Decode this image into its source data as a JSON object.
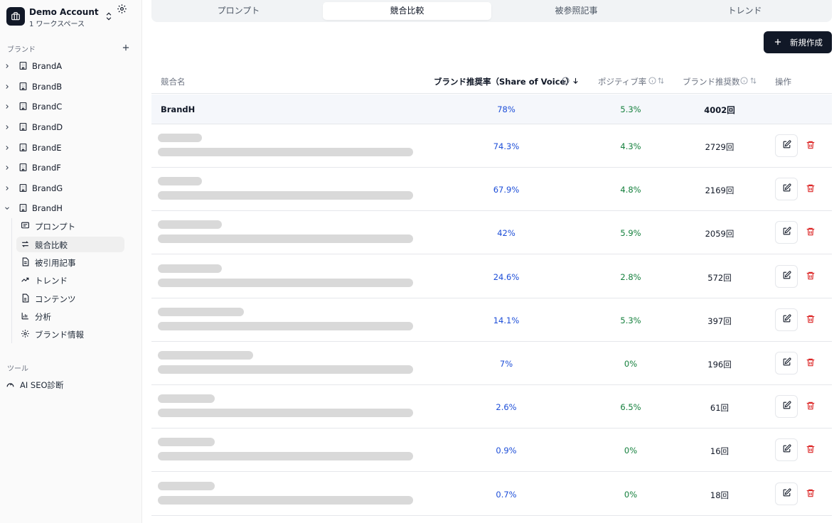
{
  "account": {
    "name": "Demo Account",
    "sub": "1 ワークスペース"
  },
  "sidebar": {
    "brand_section_label": "ブランド",
    "brands": [
      "BrandA",
      "BrandB",
      "BrandC",
      "BrandD",
      "BrandE",
      "BrandF",
      "BrandG",
      "BrandH"
    ],
    "expanded_brand": "BrandH",
    "subitems": [
      {
        "label": "プロンプト",
        "icon": "message-square-icon"
      },
      {
        "label": "競合比較",
        "icon": "arrows-swap-icon",
        "active": true
      },
      {
        "label": "被引用記事",
        "icon": "file-text-icon"
      },
      {
        "label": "トレンド",
        "icon": "trending-up-icon"
      },
      {
        "label": "コンテンツ",
        "icon": "file-icon"
      },
      {
        "label": "分析",
        "icon": "bar-chart-icon"
      },
      {
        "label": "ブランド情報",
        "icon": "gear-icon"
      }
    ],
    "tools_label": "ツール",
    "tools": [
      {
        "label": "AI SEO診断",
        "icon": "gauge-icon"
      }
    ]
  },
  "tabs": [
    {
      "label": "プロンプト"
    },
    {
      "label": "競合比較",
      "active": true
    },
    {
      "label": "被参照記事"
    },
    {
      "label": "トレンド"
    }
  ],
  "new_button": {
    "label": "新規作成"
  },
  "table": {
    "headers": {
      "name": "競合名",
      "sov": "ブランド推奨率（Share of Voice）",
      "positive": "ポジティブ率",
      "count": "ブランド推奨数",
      "actions": "操作"
    },
    "own_row": {
      "name": "BrandH",
      "sov": "78%",
      "positive": "5.3%",
      "count": "4002回"
    },
    "rows": [
      {
        "sov": "74.3%",
        "positive": "4.3%",
        "count": "2729回"
      },
      {
        "sov": "67.9%",
        "positive": "4.8%",
        "count": "2169回"
      },
      {
        "sov": "42%",
        "positive": "5.9%",
        "count": "2059回"
      },
      {
        "sov": "24.6%",
        "positive": "2.8%",
        "count": "572回"
      },
      {
        "sov": "14.1%",
        "positive": "5.3%",
        "count": "397回"
      },
      {
        "sov": "7%",
        "positive": "0%",
        "count": "196回"
      },
      {
        "sov": "2.6%",
        "positive": "6.5%",
        "count": "61回"
      },
      {
        "sov": "0.9%",
        "positive": "0%",
        "count": "16回"
      },
      {
        "sov": "0.7%",
        "positive": "0%",
        "count": "18回"
      }
    ]
  },
  "colors": {
    "sov": "#1d4ed8",
    "positive": "#15803d",
    "delete": "#dc2626",
    "primary": "#111827"
  }
}
